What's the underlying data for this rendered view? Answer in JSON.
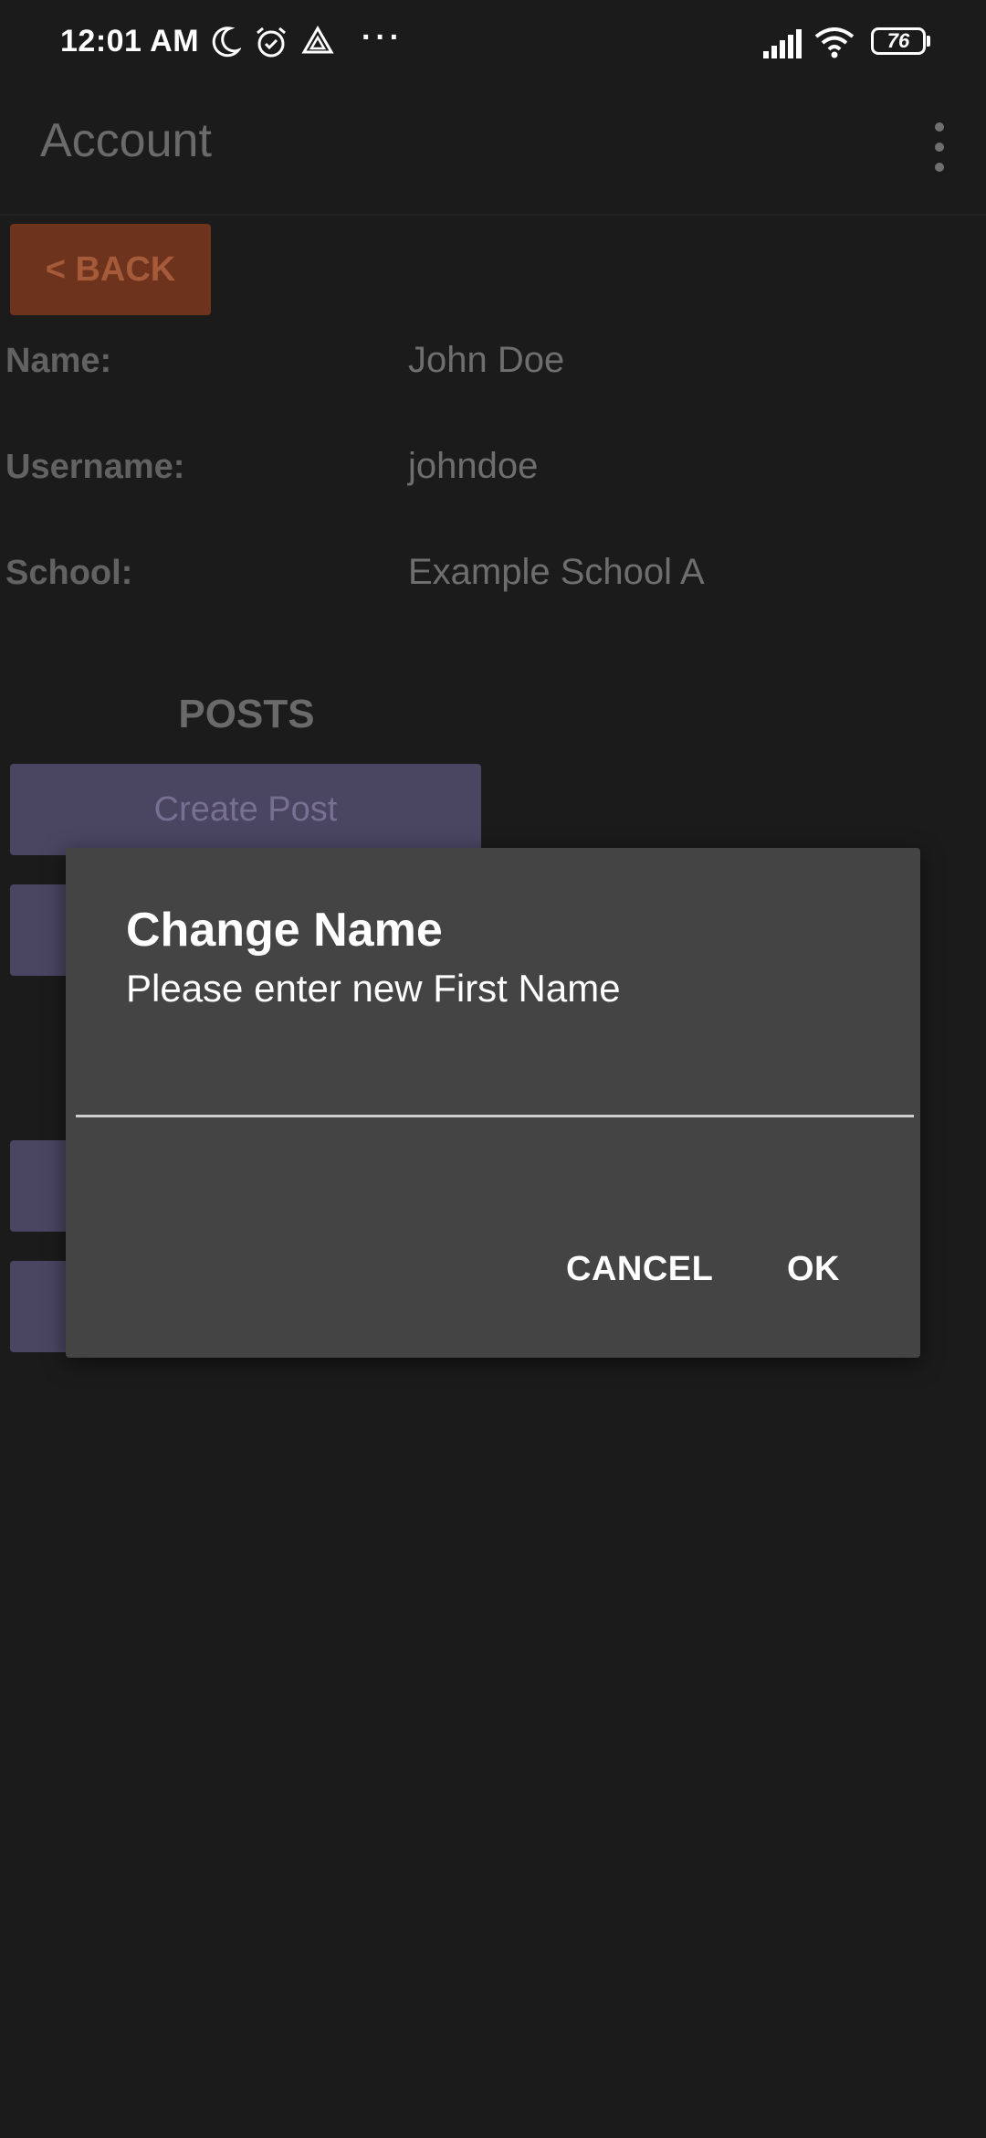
{
  "status_bar": {
    "time": "12:01 AM",
    "icons": [
      "moon-icon",
      "alarm-icon",
      "drive-icon",
      "more-dots-icon"
    ],
    "right_icons": [
      "signal-icon",
      "wifi-icon",
      "battery-icon"
    ],
    "battery": "76"
  },
  "app_bar": {
    "title": "Account",
    "menu_icon": "overflow-menu-icon"
  },
  "back_button": {
    "label": "< BACK"
  },
  "profile": {
    "fields": [
      {
        "label": "Name:",
        "value": "John Doe"
      },
      {
        "label": "Username:",
        "value": "johndoe"
      },
      {
        "label": "School:",
        "value": "Example School A"
      }
    ]
  },
  "posts": {
    "heading": "POSTS",
    "create_label": "Create Post"
  },
  "dialog": {
    "title": "Change Name",
    "message": "Please enter new First Name",
    "input_value": "",
    "cancel_label": "CANCEL",
    "ok_label": "OK"
  },
  "colors": {
    "background": "#1b1b1b",
    "dialog": "#444444",
    "back_button": "#6e331d",
    "purple_button": "#4a4561"
  }
}
